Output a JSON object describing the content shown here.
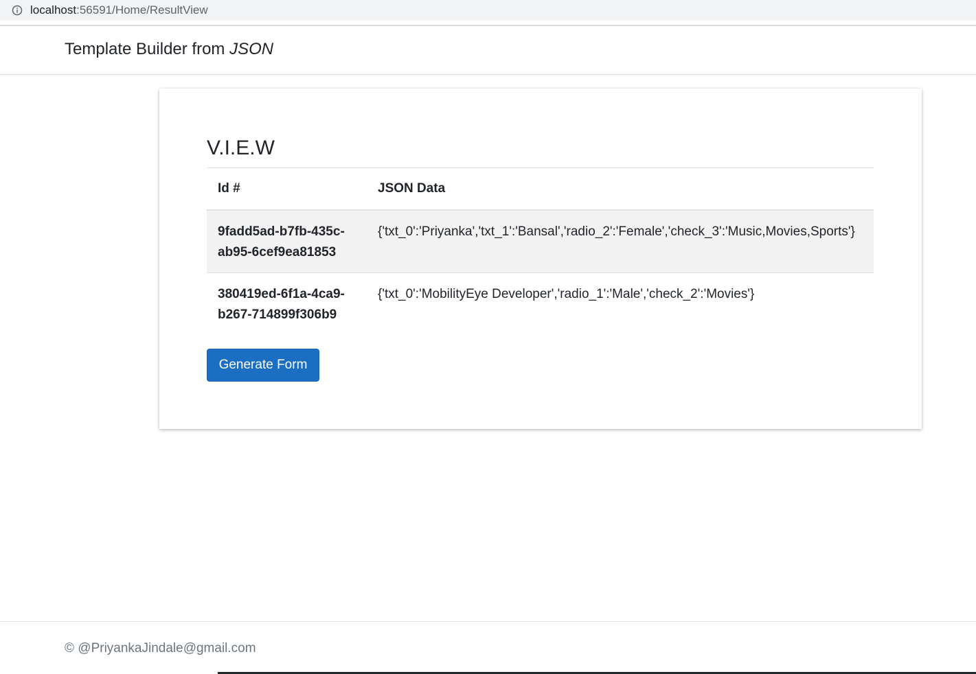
{
  "browser": {
    "url_host": "localhost",
    "url_rest": ":56591/Home/ResultView",
    "info_icon": "info-circle-icon"
  },
  "navbar": {
    "brand_prefix": "Template Builder from ",
    "brand_emphasis": "JSON"
  },
  "card": {
    "title": "V.I.E.W",
    "table": {
      "headers": [
        "Id #",
        "JSON Data"
      ],
      "rows": [
        {
          "id": "9fadd5ad-b7fb-435c-ab95-6cef9ea81853",
          "json": "{'txt_0':'Priyanka','txt_1':'Bansal','radio_2':'Female','check_3':'Music,Movies,Sports'}"
        },
        {
          "id": "380419ed-6f1a-4ca9-b267-714899f306b9",
          "json": "{'txt_0':'MobilityEye Developer','radio_1':'Male','check_2':'Movies'}"
        }
      ]
    },
    "generate_button": "Generate Form"
  },
  "footer": {
    "copyright": "© @PriyankaJindale@gmail.com"
  },
  "colors": {
    "primary_button": "#1b6ec2",
    "striped_row": "#f2f2f2",
    "address_bar": "#f1f3f4"
  }
}
